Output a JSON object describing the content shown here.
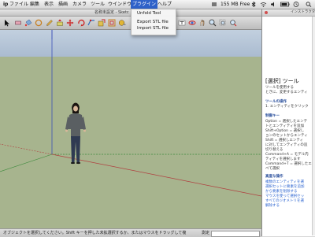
{
  "menubar": {
    "app_label": "ip",
    "items": [
      "ファイル",
      "編集",
      "表示",
      "描画",
      "カメラ",
      "ツール",
      "ウインドウ",
      "プラグイン",
      "ヘルプ"
    ],
    "active_item": "プラグイン",
    "memory": "155 MB Free",
    "accent_color": "#2f62c9"
  },
  "plugin_menu": {
    "items": [
      "Unfold Tool",
      "Export STL file",
      "Import STL file"
    ]
  },
  "window": {
    "title": "名称未設定 - Sketc"
  },
  "toolbar": {
    "icons": [
      "select-arrow-icon",
      "eraser-icon",
      "paint-bucket-icon",
      "circle-icon",
      "pencil-icon",
      "push-pull-icon",
      "move-icon",
      "rotate-icon",
      "follow-me-icon",
      "scale-icon",
      "offset-icon",
      "tape-measure-icon",
      "text-icon",
      "orbit-icon",
      "pan-icon",
      "zoom-icon"
    ]
  },
  "statusbar": {
    "message": "オブジェクトを選択してください。Shift キーを押した未拡選択するか、またはマウスをドラッグして複",
    "measure_label": "測定"
  },
  "panel": {
    "title": "インストラクタ",
    "heading": "[選択] ツール",
    "intro": [
      "ツールを使用する",
      "ときに、変更するエンティ"
    ],
    "ops_title": "ツールの操作",
    "ops": [
      "1. エンティティをクリック"
    ],
    "keys_title": "制御キー",
    "keys": [
      "Option = 選択したエンテ",
      "トとエンティティを追加",
      "Shift+Option = 選択し",
      "ョンのセットからエンティ",
      "Shift = 選択しエンティ",
      "に対してエンティティの追",
      "切り替える",
      "Command+A = モデル内",
      "ティティを選択します",
      "Command+T = 選択したエ",
      "べて選択"
    ],
    "adv_title": "高度な操作",
    "adv": [
      "複数のエンティティを選",
      "選択セットに要素を追加",
      "から要素を削除する",
      "マウスを使って選択セッ",
      "すべてのジオメトリを選",
      "解除する"
    ]
  },
  "viewport": {
    "sky_color": "#b5c4d6",
    "ground_color": "#a7b48e",
    "axis_green": "#3b8a3b",
    "axis_red": "#b04040",
    "axis_blue": "#3a4fb8"
  }
}
